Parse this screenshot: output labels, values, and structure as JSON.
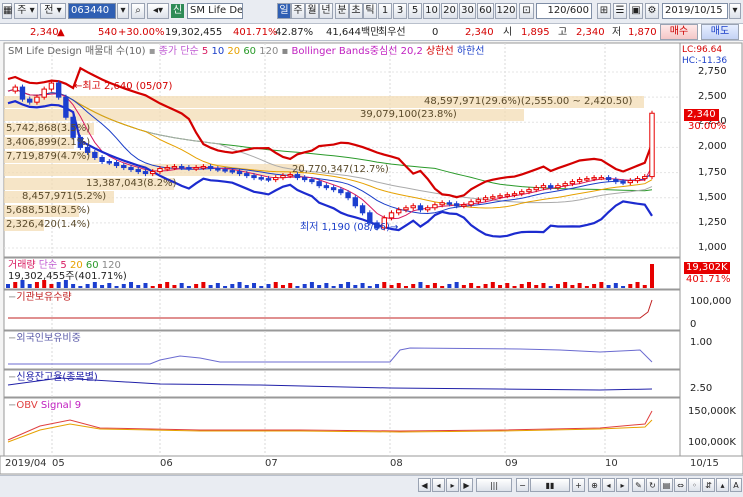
{
  "toolbar": {
    "period_label": "주",
    "code_label": "전",
    "code_value": "063440",
    "corp_tag": "신",
    "stock_name": "SM Life De",
    "period_tabs": [
      "일",
      "주",
      "월",
      "년",
      "분",
      "초",
      "틱"
    ],
    "minute_options": [
      "1",
      "3",
      "5",
      "10",
      "20",
      "30",
      "60",
      "120"
    ],
    "count_value": "120/600",
    "date_value": "2019/10/15"
  },
  "quote": {
    "price": "2,340",
    "change": "540",
    "change_pct": "+30.00%",
    "volume": "19,302,455",
    "volume_ratio": "401.71%",
    "turnover": "42.87%",
    "amount": "41,644백만",
    "tag_label": "최우선",
    "tag_value": "0",
    "ask": "2,340",
    "open_label": "시",
    "open": "1,895",
    "high_label": "고",
    "high": "2,340",
    "low_label": "저",
    "low": "1,870",
    "buy_label": "매수",
    "sell_label": "매도"
  },
  "panels": {
    "price": {
      "title": "SM Life Design 매물대 수(10)",
      "ma_label": "종가 단순",
      "ma_periods": [
        "5",
        "10",
        "20",
        "60",
        "120"
      ],
      "bb_label": "Bollinger Bands중심선 20,2",
      "bb_upper": "상한선",
      "bb_lower": "하한선",
      "max_note": "최고 2,640 (05/07)",
      "min_note": "최저 1,190 (08/06)",
      "cur_price_tag": "2,340",
      "cur_pct_tag": "30.00%",
      "lc": "LC:96.64",
      "hc": "HC:-11.36",
      "volume_profile": [
        "48,597,971(29.6%)(2,555.00 ~ 2,420.50)",
        "39,079,100(23.8%)",
        "5,742,868(3.5%)",
        "3,406,899(2.1%)",
        "7,719,879(4.7%)",
        "13,387,043(8.2%)",
        "20,770,347(12.7%)",
        "8,457,971(5.2%)",
        "5,688,518(3.5%)",
        "2,326,420(1.4%)"
      ],
      "y_ticks": [
        "2,750",
        "2,500",
        "2,250",
        "2,000",
        "1,750",
        "1,500",
        "1,250",
        "1,000"
      ]
    },
    "volume": {
      "title": "거래량",
      "ma_label": "단순",
      "ma_periods": [
        "5",
        "20",
        "60",
        "120"
      ],
      "note": "19,302,455주(401.71%)",
      "tag_value": "19,302K",
      "tag_pct": "401.71%"
    },
    "inst": {
      "title": "기관보유수량",
      "y_ticks": [
        "100,000",
        "0"
      ]
    },
    "foreign": {
      "title": "외국인보유비중",
      "y_ticks": [
        "1.00"
      ]
    },
    "credit": {
      "title": "신용잔고율(종목별)",
      "y_ticks": [
        "2.50"
      ]
    },
    "obv": {
      "title": "OBV",
      "signal": "Signal 9",
      "y_ticks": [
        "150,000K",
        "100,000K"
      ]
    }
  },
  "x_axis": [
    "2019/04",
    "05",
    "06",
    "07",
    "08",
    "09",
    "10",
    "10/15"
  ],
  "colors": {
    "up": "#e60000",
    "down": "#1c3ecf",
    "bb": "#d40000",
    "bbmid": "#2a9a2a",
    "accent": "#2f5fb3"
  }
}
